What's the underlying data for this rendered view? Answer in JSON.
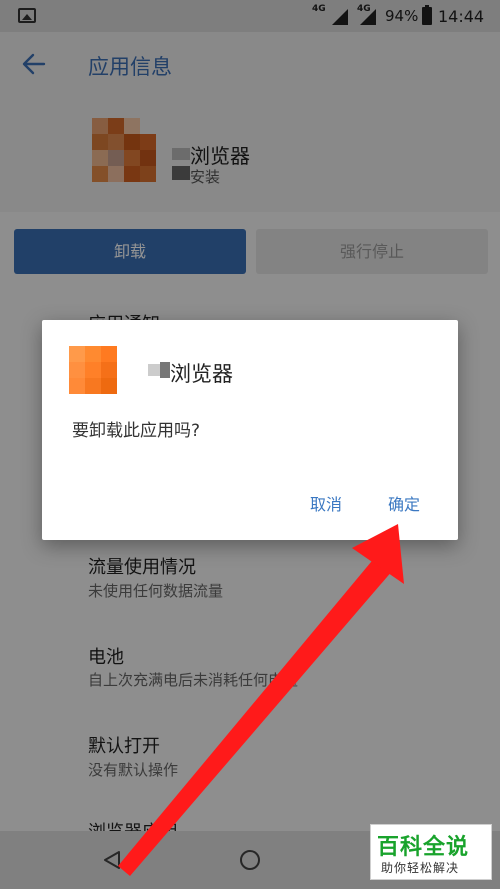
{
  "status_bar": {
    "network_1": "4G",
    "network_2": "4G",
    "battery_percent": "94%",
    "time": "14:44"
  },
  "app_bar": {
    "title": "应用信息",
    "back_icon": "arrow-left-icon"
  },
  "app_header": {
    "name": "浏览器",
    "subtitle": "安装"
  },
  "actions": {
    "uninstall_label": "卸载",
    "force_stop_label": "强行停止"
  },
  "settings": [
    {
      "title": "应用通知",
      "subtitle": ""
    },
    {
      "title": "流量使用情况",
      "subtitle": "未使用任何数据流量"
    },
    {
      "title": "电池",
      "subtitle": "自上次充满电后未消耗任何电量"
    },
    {
      "title": "默认打开",
      "subtitle": "没有默认操作"
    },
    {
      "title": "浏览器应用",
      "subtitle": ""
    }
  ],
  "dialog": {
    "title": "浏览器",
    "message": "要卸载此应用吗?",
    "cancel_label": "取消",
    "confirm_label": "确定"
  },
  "watermark": {
    "main": "百科全说",
    "sub": "助你轻松解决"
  },
  "colors": {
    "accent_blue": "#3a6fb4",
    "dialog_button": "#3b78c2",
    "arrow_red": "#ff1a1a",
    "watermark_green": "#19a32c"
  }
}
